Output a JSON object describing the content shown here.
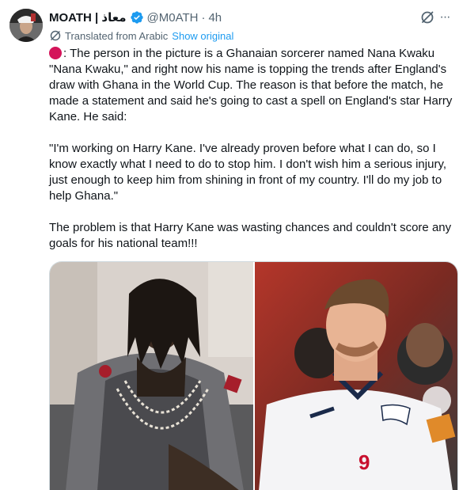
{
  "tweet": {
    "display_name": "MOATH | معاذ",
    "handle": "@M0ATH",
    "separator": "·",
    "time": "4h",
    "translated_label": "Translated from Arabic",
    "show_original_label": "Show original",
    "body": ": The person in the picture is a Ghanaian sorcerer named Nana Kwaku \"Nana Kwaku,\" and right now his name is topping the trends after England's draw with Ghana in the World Cup. The reason is that before the match, he made a statement and said he's going to cast a spell on England's star Harry Kane. He said:\n\n\"I'm working on Harry Kane. I've already proven before what I can do, so I know exactly what I need to do to stop him. I don't wish him a serious injury, just enough to keep him from shining in front of my country. I'll do my job to help Ghana.\"\n\nThe problem is that Harry Kane was wasting chances and couldn't score any goals for his national team!!!",
    "more_glyph": "···",
    "shirt_number": "9"
  },
  "icons": {
    "verified": "verified-badge-icon",
    "grok": "grok-icon",
    "more": "more-icon",
    "translate": "translate-icon",
    "red_circle": "red-circle-emoji"
  },
  "colors": {
    "link": "#1d9bf0",
    "secondary_text": "#536471",
    "verified": "#1d9bf0",
    "red_circle": "#d4145a"
  }
}
